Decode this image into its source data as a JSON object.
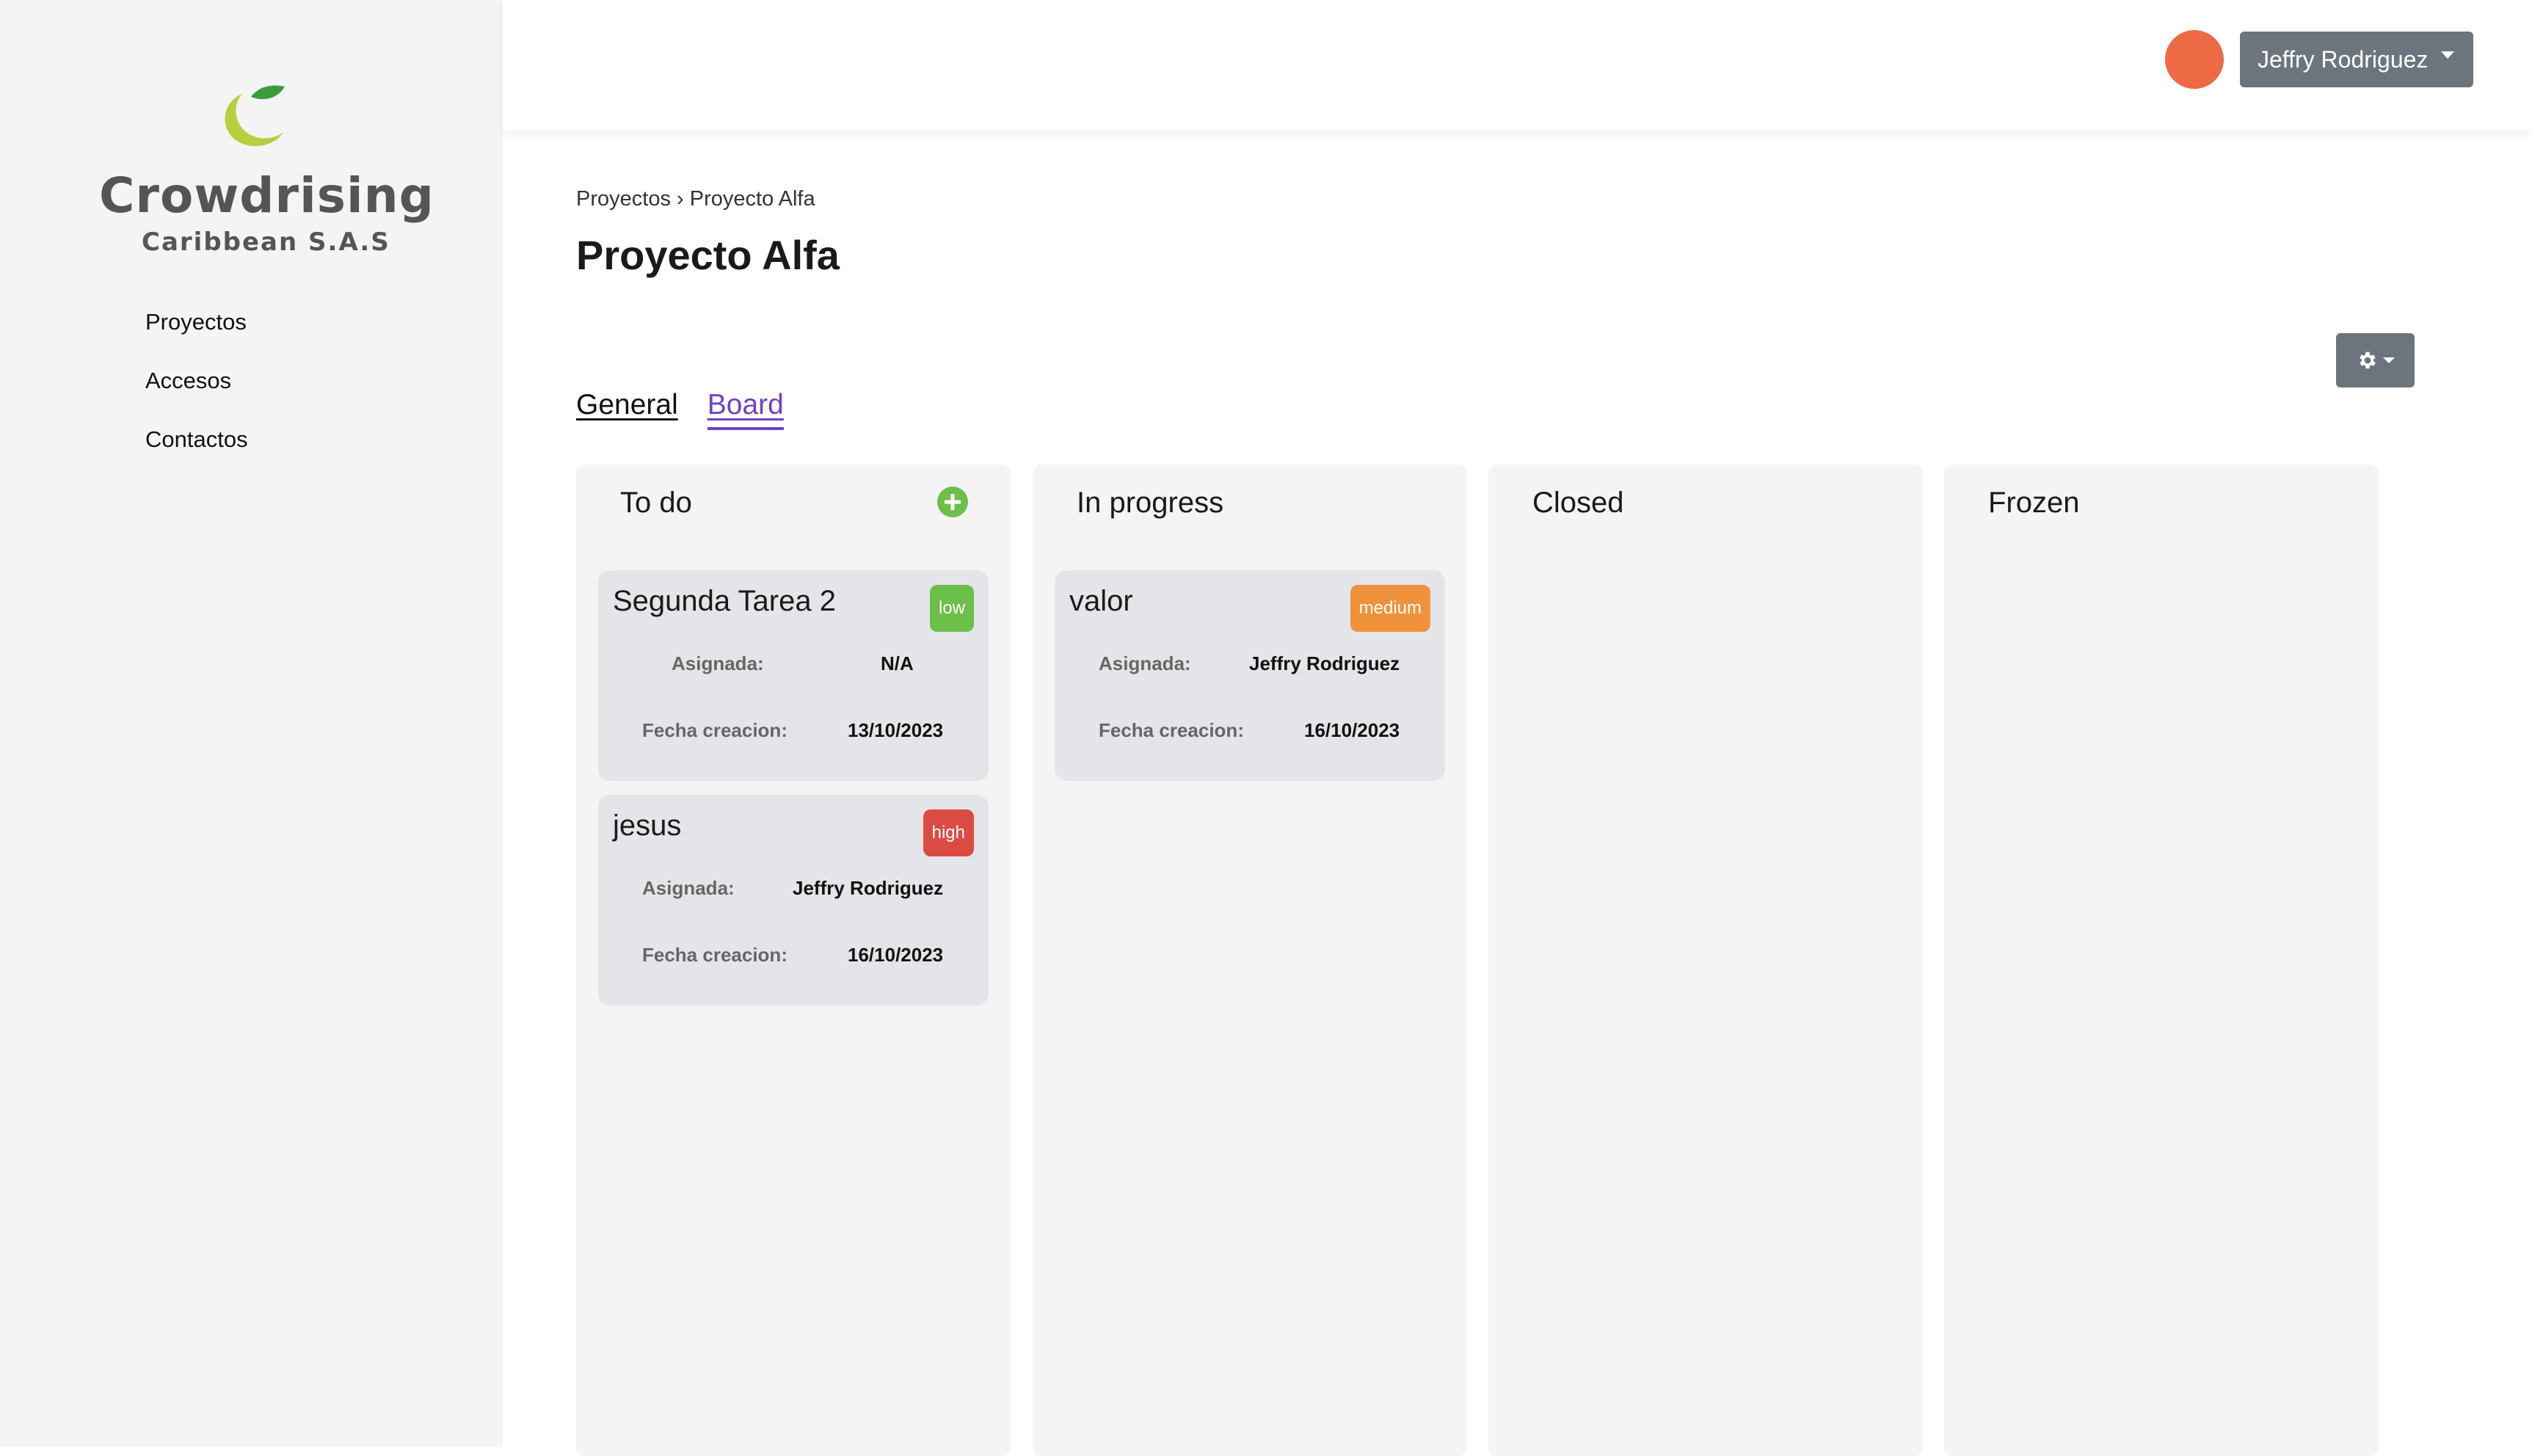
{
  "brand": {
    "name": "Crowdrising",
    "subtitle": "Caribbean S.A.S",
    "colors": {
      "leaf": "#3a9d3a",
      "moon": "#b7cf3d"
    }
  },
  "sidebar": {
    "items": [
      {
        "label": "Proyectos"
      },
      {
        "label": "Accesos"
      },
      {
        "label": "Contactos"
      }
    ]
  },
  "topbar": {
    "user_name": "Jeffry Rodriguez",
    "avatar_color": "#ed6a45"
  },
  "breadcrumb": {
    "items": [
      "Proyectos",
      "Proyecto Alfa"
    ],
    "separator": "›"
  },
  "page": {
    "title": "Proyecto Alfa",
    "settings_icon": "gear-icon"
  },
  "tabs": [
    {
      "label": "General",
      "active": false
    },
    {
      "label": "Board",
      "active": true
    }
  ],
  "board": {
    "columns": [
      {
        "title": "To do",
        "cards": [
          {
            "title": "Segunda Tarea 2",
            "priority": "low",
            "assigned_label": "Asignada:",
            "assigned_value": "N/A",
            "date_label": "Fecha creacion:",
            "date_value": "13/10/2023"
          },
          {
            "title": "jesus",
            "priority": "high",
            "assigned_label": "Asignada:",
            "assigned_value": "Jeffry Rodriguez",
            "date_label": "Fecha creacion:",
            "date_value": "16/10/2023"
          }
        ]
      },
      {
        "title": "In progress",
        "cards": [
          {
            "title": "valor",
            "priority": "medium",
            "assigned_label": "Asignada:",
            "assigned_value": "Jeffry Rodriguez",
            "date_label": "Fecha creacion:",
            "date_value": "16/10/2023"
          }
        ]
      },
      {
        "title": "Closed",
        "cards": []
      },
      {
        "title": "Frozen",
        "cards": []
      }
    ],
    "priority_colors": {
      "low": "#6cc04a",
      "medium": "#f0913c",
      "high": "#dc4b43"
    }
  }
}
